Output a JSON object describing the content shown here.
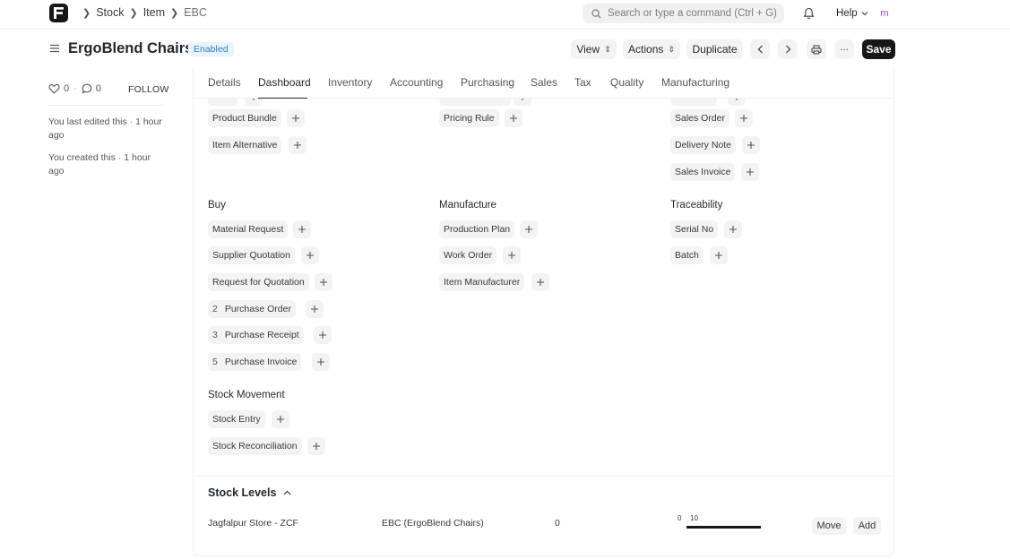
{
  "navbar": {
    "breadcrumbs": [
      "Stock",
      "Item",
      "EBC"
    ],
    "search_placeholder": "Search or type a command (Ctrl + G)",
    "help_label": "Help",
    "avatar_initial": "m"
  },
  "header": {
    "title": "ErgoBlend Chairs",
    "status": "Enabled",
    "view_label": "View",
    "actions_label": "Actions",
    "duplicate_label": "Duplicate",
    "save_label": "Save",
    "more_label": "···"
  },
  "sidebar": {
    "likes": "0",
    "comments": "0",
    "follow_label": "FOLLOW",
    "last_edited": "You last edited this · 1 hour ago",
    "created": "You created this · 1 hour ago"
  },
  "tabs": [
    "Details",
    "Dashboard",
    "Inventory",
    "Accounting",
    "Purchasing",
    "Sales",
    "Tax",
    "Quality",
    "Manufacturing"
  ],
  "active_tab": "Dashboard",
  "connections": {
    "col1_top": [
      "Product Bundle",
      "Item Alternative"
    ],
    "col2_top": [
      "Pricing Rule"
    ],
    "col3_top": [
      "Sales Order",
      "Delivery Note",
      "Sales Invoice"
    ],
    "buy": {
      "title": "Buy",
      "items": [
        {
          "label": "Material Request",
          "count": ""
        },
        {
          "label": "Supplier Quotation",
          "count": ""
        },
        {
          "label": "Request for Quotation",
          "count": ""
        },
        {
          "label": "Purchase Order",
          "count": "2"
        },
        {
          "label": "Purchase Receipt",
          "count": "3"
        },
        {
          "label": "Purchase Invoice",
          "count": "5"
        }
      ]
    },
    "manufacture": {
      "title": "Manufacture",
      "items": [
        "Production Plan",
        "Work Order",
        "Item Manufacturer"
      ]
    },
    "traceability": {
      "title": "Traceability",
      "items": [
        "Serial No",
        "Batch"
      ]
    },
    "stock_movement": {
      "title": "Stock Movement",
      "items": [
        "Stock Entry",
        "Stock Reconciliation"
      ]
    }
  },
  "stock_levels": {
    "title": "Stock Levels",
    "warehouse": "Jagfalpur Store - ZCF",
    "item": "EBC (ErgoBlend Chairs)",
    "qty": "0",
    "bar_min": "0",
    "bar_max": "10",
    "move_label": "Move",
    "add_label": "Add"
  }
}
